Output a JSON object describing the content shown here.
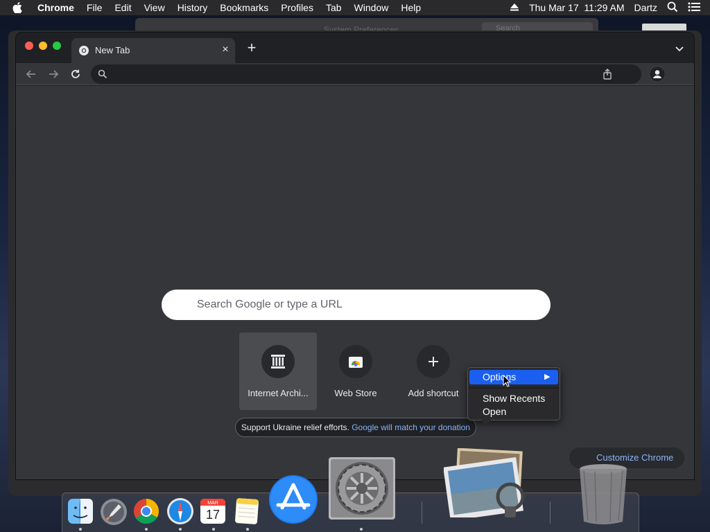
{
  "menubar": {
    "apple_icon": "apple-icon",
    "app_name": "Chrome",
    "items": [
      "File",
      "Edit",
      "View",
      "History",
      "Bookmarks",
      "Profiles",
      "Tab",
      "Window",
      "Help"
    ],
    "clock": "Thu Mar 17  11:29 AM",
    "user": "Dartz"
  },
  "background_window": {
    "title": "System Preferences",
    "search_placeholder": "Search"
  },
  "browser": {
    "tab_title": "New Tab",
    "omnibox_value": "",
    "accent_color": "#8ab4f8"
  },
  "ntp": {
    "search_placeholder": "Search Google or type a URL",
    "shortcuts": [
      {
        "label": "Internet Archi...",
        "icon": "archive-icon"
      },
      {
        "label": "Web Store",
        "icon": "web-store-icon"
      },
      {
        "label": "Add shortcut",
        "icon": "plus-icon"
      }
    ],
    "promo_text": "Support Ukraine relief efforts.",
    "promo_link": "Google will match your donation",
    "customize_label": "Customize Chrome"
  },
  "context_menu": {
    "items": [
      "Options",
      "Show Recents",
      "Open"
    ],
    "highlighted": "Options",
    "highlight_color": "#1b5ff0"
  },
  "calendar": {
    "month": "MAR",
    "day": "17"
  },
  "dock": {
    "apps": [
      "Finder",
      "Launchpad",
      "Google Chrome",
      "Safari",
      "Calendar",
      "Notes",
      "App Store",
      "System Preferences",
      "Preview",
      "Trash"
    ]
  }
}
